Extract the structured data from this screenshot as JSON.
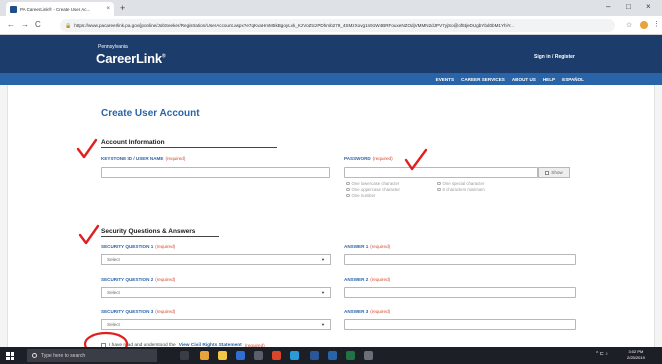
{
  "browser": {
    "tab_title": "PA CareerLink® - Create User Ac...",
    "tab_close": "×",
    "new_tab": "+",
    "url": "https://www.pacareerlink.pa.gov/jponline/JobSeeker/Registration/UserAccount.aspx?e7qKvaHmM5kBgoyLvk_KzVoZtczPDhmb279_4SMzXovg1n91W4BRFouxeNZOdjVMMN2dJPV7yjSo@of5tjeDUgbYbd0bM1YhiY...",
    "window_controls": [
      "–",
      "□",
      "×"
    ],
    "icons": [
      "back-icon",
      "forward-icon",
      "reload-icon",
      "lock-icon",
      "star-icon",
      "extension-icon",
      "menu-icon"
    ]
  },
  "site": {
    "logo_top": "Pennsylvania",
    "logo_main": "CareerLink",
    "logo_reg": "®",
    "signin": "Sign in / Register",
    "nav": [
      "EVENTS",
      "CAREER SERVICES",
      "ABOUT US",
      "HELP",
      "ESPAÑOL"
    ],
    "colors": {
      "header": "#1c3d6b",
      "nav": "#2a64a8",
      "title": "#2a64a8",
      "required": "#d24a2c",
      "annotation": "#e02020"
    }
  },
  "form": {
    "title": "Create User Account",
    "required": "(required)",
    "account_section": "Account Information",
    "keystone_label": "KEYSTONE ID / USER NAME",
    "password_label": "PASSWORD",
    "show_label": "Show",
    "password_rules": [
      "One lowercase character",
      "One uppercase character",
      "One number",
      "One special character",
      "8 characters minimum"
    ],
    "security_section": "Security Questions & Answers",
    "q1_label": "SECURITY QUESTION 1",
    "q2_label": "SECURITY QUESTION 2",
    "q3_label": "SECURITY QUESTION 3",
    "a1_label": "ANSWER 1",
    "a2_label": "ANSWER 2",
    "a3_label": "ANSWER 3",
    "select_placeholder": "Select",
    "agree_prefix": "I have read and understood the",
    "agree_link": "View Civil Rights Statement"
  },
  "taskbar": {
    "search_placeholder": "Type here to search",
    "time": "3:02 PM",
    "date": "2/25/2019"
  }
}
